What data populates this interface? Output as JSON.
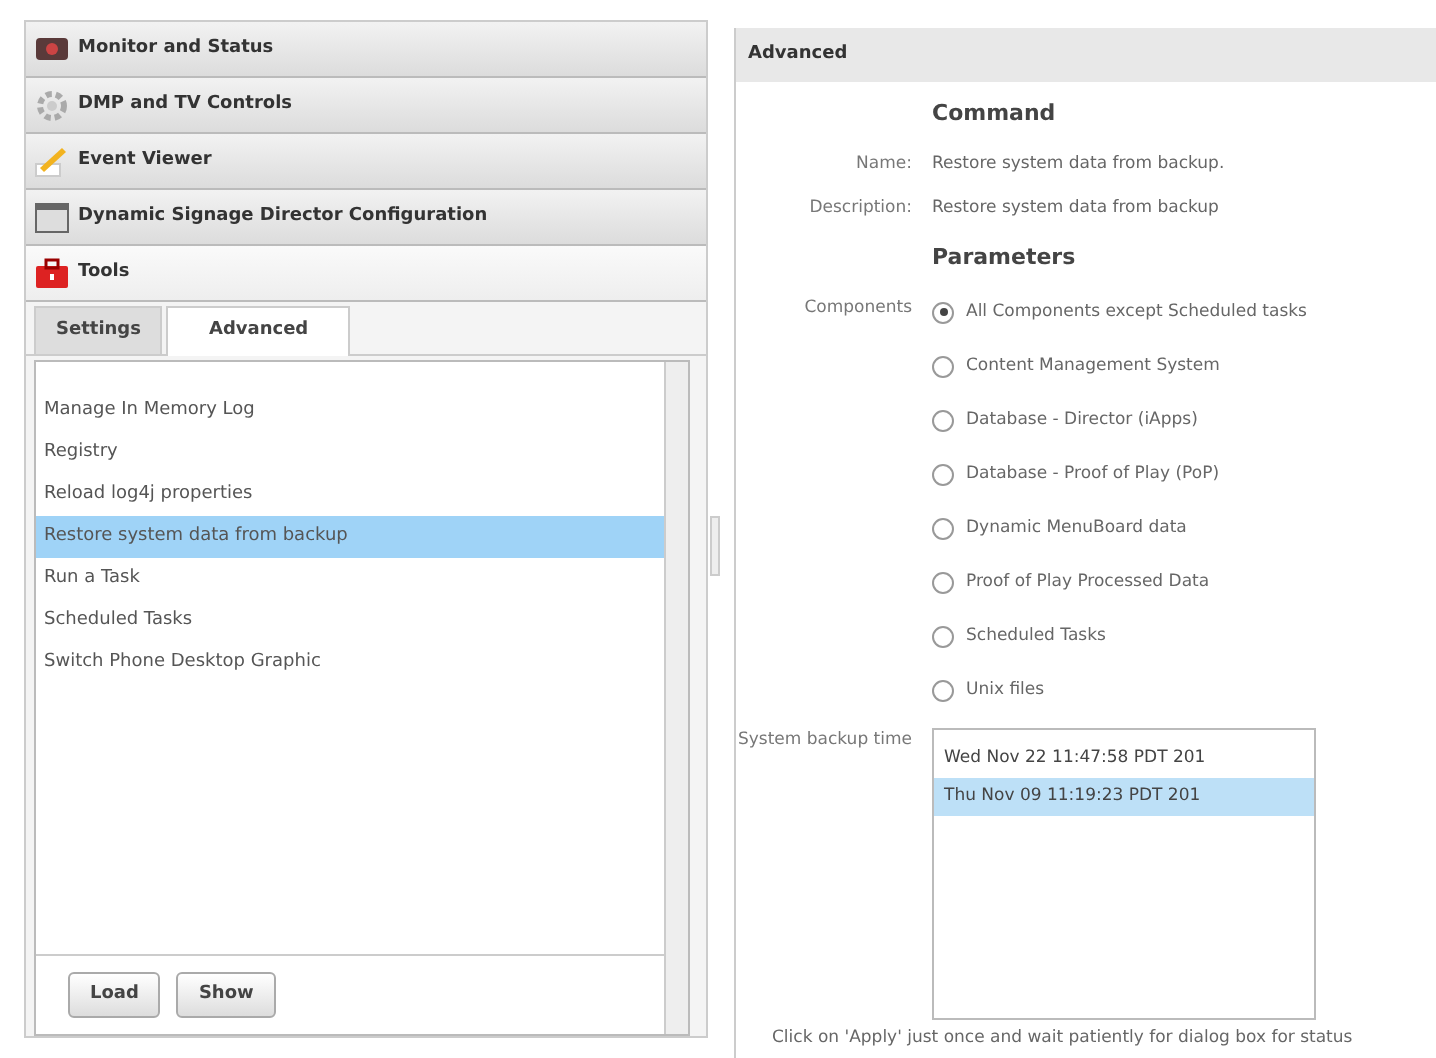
{
  "accordion": [
    {
      "label": "Monitor and Status",
      "expanded": false
    },
    {
      "label": "DMP and TV Controls",
      "expanded": false
    },
    {
      "label": "Event Viewer",
      "expanded": false
    },
    {
      "label": "Dynamic Signage Director Configuration",
      "expanded": false
    },
    {
      "label": "Tools",
      "expanded": true
    }
  ],
  "tabs": [
    {
      "label": "Settings",
      "selected": false
    },
    {
      "label": "Advanced",
      "selected": true
    }
  ],
  "task_list": [
    {
      "label": "Manage In Memory Log",
      "selected": false
    },
    {
      "label": "Registry",
      "selected": false
    },
    {
      "label": "Reload log4j properties",
      "selected": false
    },
    {
      "label": "Restore system data from backup",
      "selected": true
    },
    {
      "label": "Run a Task",
      "selected": false
    },
    {
      "label": "Scheduled Tasks",
      "selected": false
    },
    {
      "label": "Switch Phone Desktop Graphic",
      "selected": false
    }
  ],
  "buttons": [
    "Load",
    "Show"
  ],
  "panel": {
    "title": "Advanced",
    "command_heading": "Command",
    "fields": [
      {
        "label": "Name:",
        "value": "Restore system data from backup."
      },
      {
        "label": "Description:",
        "value": "Restore system data from backup"
      }
    ],
    "parameters_heading": "Parameters",
    "components_label": "Components",
    "components": [
      {
        "label": "All Components except Scheduled tasks",
        "selected": true
      },
      {
        "label": "Content Management System",
        "selected": false
      },
      {
        "label": "Database - Director (iApps)",
        "selected": false
      },
      {
        "label": "Database - Proof of Play (PoP)",
        "selected": false
      },
      {
        "label": "Dynamic MenuBoard data",
        "selected": false
      },
      {
        "label": "Proof of Play Processed Data",
        "selected": false
      },
      {
        "label": "Scheduled Tasks",
        "selected": false
      },
      {
        "label": "Unix files",
        "selected": false
      }
    ],
    "backup_label": "System backup time",
    "backups": [
      {
        "label": "Wed Nov 22 11:47:58 PDT 201",
        "selected": false
      },
      {
        "label": "Thu Nov 09 11:19:23 PDT 201",
        "selected": true
      }
    ],
    "note": "Click on 'Apply' just once and wait patiently for dialog box for status"
  }
}
